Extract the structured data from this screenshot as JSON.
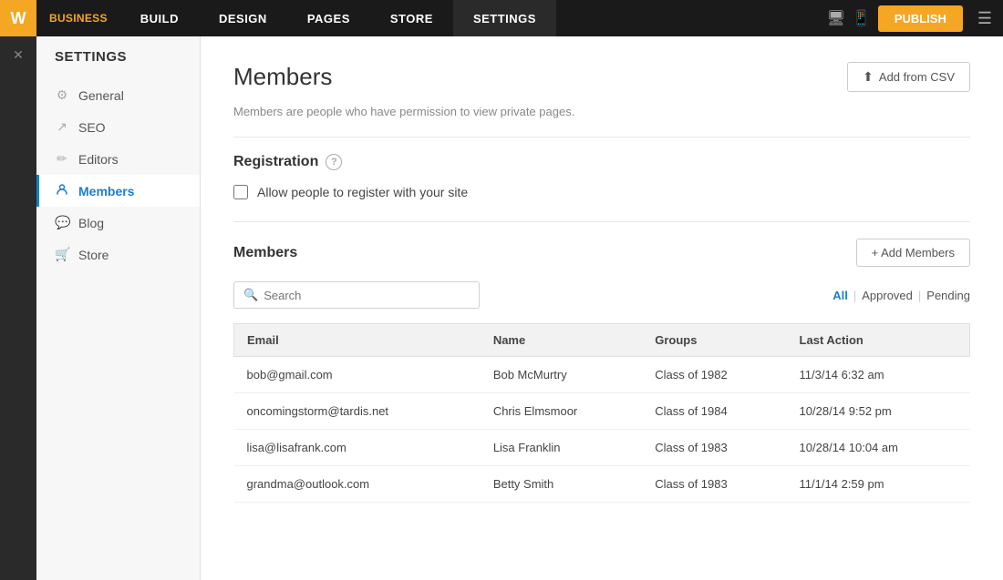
{
  "topNav": {
    "logo": "W",
    "logoLabel": "BUSINESS",
    "items": [
      {
        "label": "BUILD",
        "active": false
      },
      {
        "label": "DESIGN",
        "active": false
      },
      {
        "label": "PAGES",
        "active": false
      },
      {
        "label": "STORE",
        "active": false
      },
      {
        "label": "SETTINGS",
        "active": true
      }
    ],
    "publishLabel": "PUBLISH"
  },
  "sidebar": {
    "title": "SETTINGS",
    "items": [
      {
        "label": "General",
        "icon": "⚙",
        "active": false,
        "name": "general"
      },
      {
        "label": "SEO",
        "icon": "↗",
        "active": false,
        "name": "seo"
      },
      {
        "label": "Editors",
        "icon": "✏",
        "active": false,
        "name": "editors"
      },
      {
        "label": "Members",
        "icon": "👤",
        "active": true,
        "name": "members"
      },
      {
        "label": "Blog",
        "icon": "💬",
        "active": false,
        "name": "blog"
      },
      {
        "label": "Store",
        "icon": "🛒",
        "active": false,
        "name": "store"
      }
    ]
  },
  "main": {
    "pageTitle": "Members",
    "addFromCSVLabel": "Add from CSV",
    "uploadIcon": "↑",
    "descriptionText": "Members are people who have permission to view private pages.",
    "registrationSection": {
      "title": "Registration",
      "checkboxLabel": "Allow people to register with your site"
    },
    "membersSection": {
      "title": "Members",
      "addMembersLabel": "+ Add Members",
      "searchPlaceholder": "Search",
      "filterTabs": [
        {
          "label": "All",
          "active": true
        },
        {
          "label": "Approved",
          "active": false
        },
        {
          "label": "Pending",
          "active": false
        }
      ],
      "tableHeaders": [
        "Email",
        "Name",
        "Groups",
        "Last Action"
      ],
      "tableRows": [
        {
          "email": "bob@gmail.com",
          "name": "Bob McMurtry",
          "groups": "Class of 1982",
          "lastAction": "11/3/14 6:32 am"
        },
        {
          "email": "oncomingstorm@tardis.net",
          "name": "Chris Elmsmoor",
          "groups": "Class of 1984",
          "lastAction": "10/28/14 9:52 pm"
        },
        {
          "email": "lisa@lisafrank.com",
          "name": "Lisa Franklin",
          "groups": "Class of 1983",
          "lastAction": "10/28/14 10:04 am"
        },
        {
          "email": "grandma@outlook.com",
          "name": "Betty Smith",
          "groups": "Class of 1983",
          "lastAction": "11/1/14 2:59 pm"
        }
      ]
    }
  }
}
